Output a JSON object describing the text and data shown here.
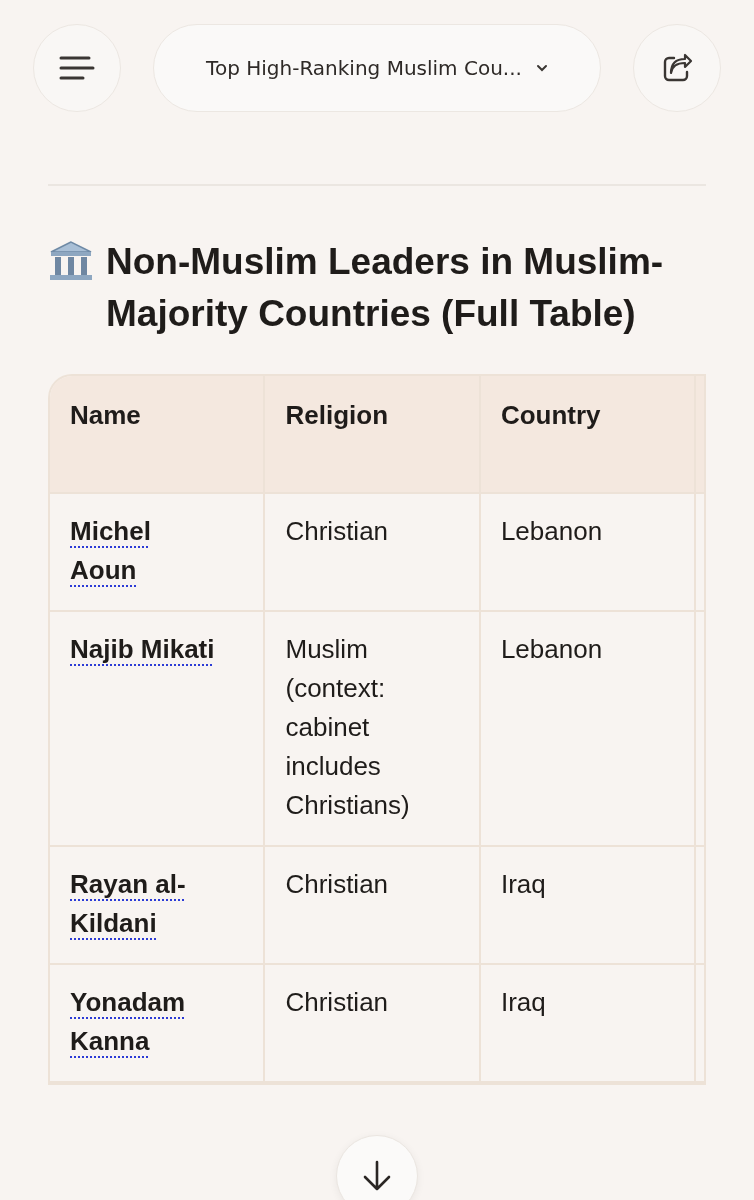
{
  "header": {
    "title": "Top High-Ranking Muslim Cou..."
  },
  "heading": "Non-Muslim Leaders in Muslim-Majority Countries (Full Table)",
  "table": {
    "columns": [
      "Name",
      "Religion",
      "Country"
    ],
    "rows": [
      {
        "name": "Michel Aoun",
        "religion": "Christian",
        "country": "Lebanon"
      },
      {
        "name": "Najib Mikati",
        "religion": "Muslim (context: cabinet includes Christians)",
        "country": "Lebanon"
      },
      {
        "name": "Rayan al-Kildani",
        "religion": "Christian",
        "country": "Iraq"
      },
      {
        "name": "Yonadam Kanna",
        "religion": "Christian",
        "country": "Iraq"
      }
    ]
  }
}
